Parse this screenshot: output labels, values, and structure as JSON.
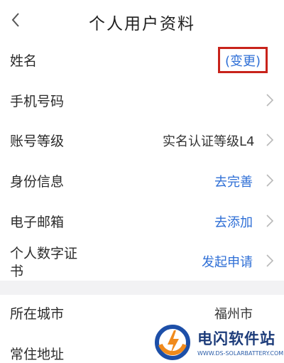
{
  "header": {
    "title": "个人用户资料"
  },
  "rows": [
    {
      "label": "姓名",
      "value": "(变更)",
      "value_color": "#2f6fd6"
    },
    {
      "label": "手机号码",
      "value": ""
    },
    {
      "label": "账号等级",
      "value": "实名认证等级L4",
      "value_color": "#333333"
    },
    {
      "label": "身份信息",
      "value": "去完善",
      "value_color": "#2f6fd6"
    },
    {
      "label": "电子邮箱",
      "value": "去添加",
      "value_color": "#2f6fd6"
    },
    {
      "label_line1": "个人数字证",
      "label_line2": "书",
      "value": "发起申请",
      "value_color": "#2f6fd6"
    }
  ],
  "rows2": [
    {
      "label": "所在城市",
      "value": "福州市"
    },
    {
      "label": "常住地址",
      "value": ""
    }
  ],
  "watermark": {
    "name": "电闪软件站",
    "url": "WWW.DS-SOLARBATTERY.COM"
  },
  "icons": {
    "back": "back-chevron-icon",
    "row_arrow": "chevron-right-icon"
  }
}
